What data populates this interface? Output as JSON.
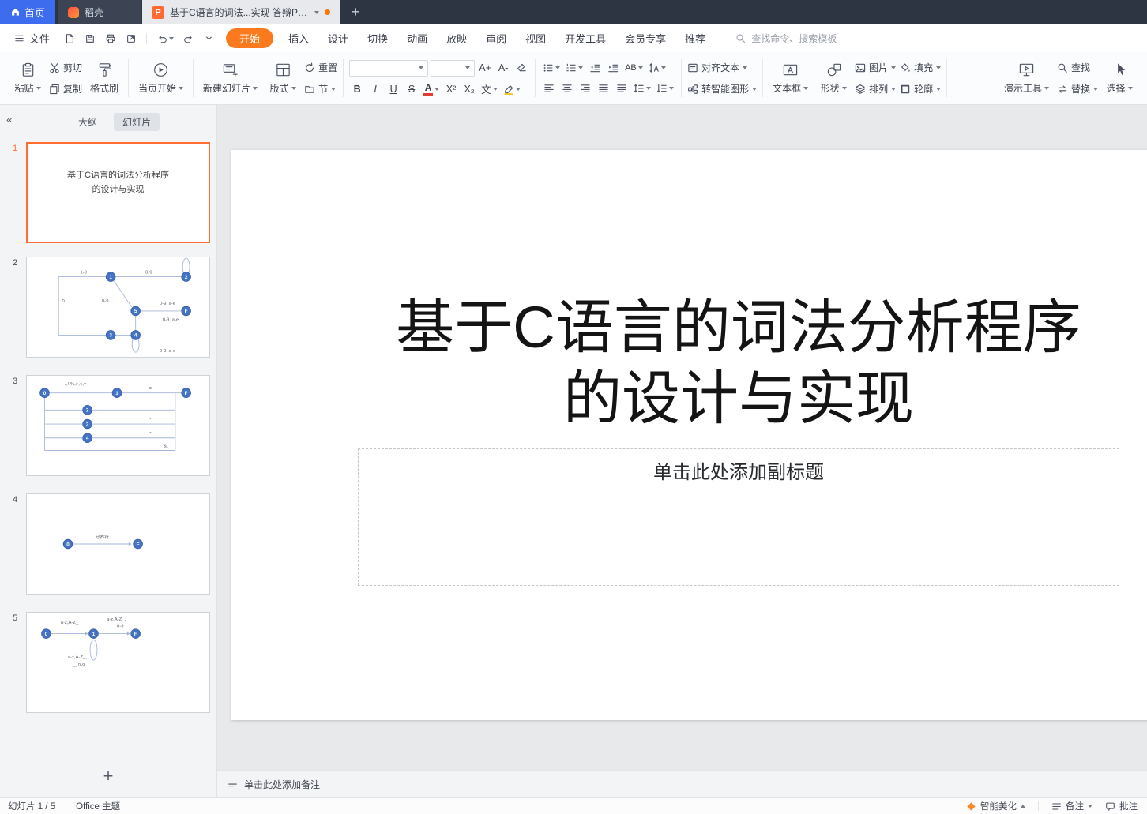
{
  "colors": {
    "accent_orange": "#ff6e31",
    "ribbon_active_tab": "#fb7a1e",
    "home_button_blue": "#3d6dee",
    "diagram_node_blue": "#4472c4"
  },
  "titlebar": {
    "home_label": "首页",
    "docer_label": "稻壳",
    "doc_tab_label": "基于C语言的词法...实现 答辩PPT",
    "doc_icon_letter": "P",
    "new_tab_label": "+"
  },
  "menubar": {
    "file_label": "文件",
    "tabs": [
      {
        "label": "开始"
      },
      {
        "label": "插入"
      },
      {
        "label": "设计"
      },
      {
        "label": "切换"
      },
      {
        "label": "动画"
      },
      {
        "label": "放映"
      },
      {
        "label": "审阅"
      },
      {
        "label": "视图"
      },
      {
        "label": "开发工具"
      },
      {
        "label": "会员专享"
      },
      {
        "label": "推荐"
      }
    ],
    "search_placeholder": "查找命令、搜索模板"
  },
  "ribbon": {
    "paste_label": "粘贴",
    "cut_label": "剪切",
    "copy_label": "复制",
    "painter_label": "格式刷",
    "play_label": "当页开始",
    "new_slide_label": "新建幻灯片",
    "layout_label": "版式",
    "reset_label": "重置",
    "section_label": "节",
    "font_name_value": "",
    "font_size_value": "",
    "grow_font": "A+",
    "shrink_font": "A-",
    "font_bold": "B",
    "font_italic": "I",
    "font_underline": "U",
    "font_strike": "S",
    "font_color": "A",
    "superscript": "X²",
    "subscript": "X₂",
    "pinyin": "文",
    "ab_label": "AB",
    "align_text_label": "对齐文本",
    "smart_label": "转智能图形",
    "textbox_label": "文本框",
    "shape_label": "形状",
    "picture_label": "图片",
    "fill_label": "填充",
    "arrange_label": "排列",
    "outline_label": "轮廓",
    "tools_label": "演示工具",
    "find_label": "查找",
    "replace_label": "替换",
    "select_label": "选择"
  },
  "sidebar": {
    "collapse_glyph": "«",
    "outline_tab": "大纲",
    "slides_tab": "幻灯片",
    "add_label": "+",
    "numbers": [
      "1",
      "2",
      "3",
      "4",
      "5"
    ]
  },
  "thumb1": {
    "line1": "基于C语言的词法分析程序",
    "line2": "的设计与实现"
  },
  "thumb2": {
    "n1": "1",
    "n2": "2",
    "n5": "5",
    "nF": "F",
    "n3": "3",
    "n4": "4",
    "l1": "1-9",
    "l2": "0-9",
    "l3": "0",
    "l4": "0-9",
    "l5": "0-9, a-e",
    "l6": "0-9, a-e",
    "l7": "0-9, a-e"
  },
  "thumb3": {
    "n0": "0",
    "n1": "1",
    "nF": "F",
    "n2": "2",
    "n3": "3",
    "n4": "4",
    "l1": "/,!,%,>,<,=",
    "l2": "=",
    "l3": "*",
    "l4": "*",
    "l5": "&,"
  },
  "thumb4": {
    "n0": "0",
    "nF": "F",
    "l1": "分界符"
  },
  "thumb5": {
    "n0": "0",
    "n1": "1",
    "nF": "F",
    "l1": "a-z,A-Z_",
    "l2": "a-z,A-Z_,",
    "l3": "_, 0-9",
    "l4": "a-z,A-Z_,",
    "l5": "_, 0-9"
  },
  "slide": {
    "title_line1": "基于C语言的词法分析程序",
    "title_line2": "的设计与实现",
    "subtitle_placeholder": "单击此处添加副标题"
  },
  "notes": {
    "placeholder": "单击此处添加备注"
  },
  "statusbar": {
    "slide_counter": "幻灯片 1 / 5",
    "theme_label": "Office 主题",
    "beautify_label": "智能美化",
    "notes_label": "备注",
    "comments_label": "批注"
  }
}
